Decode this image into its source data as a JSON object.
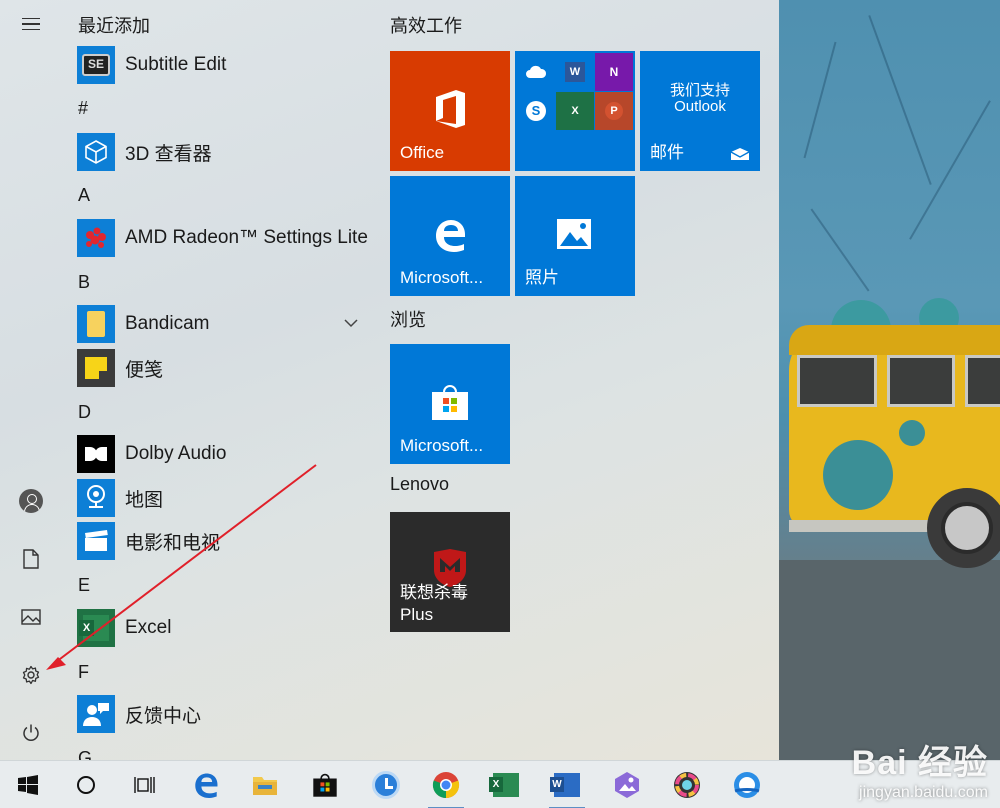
{
  "app_list": {
    "recently_added_header": "最近添加",
    "groups": [
      {
        "header": "#",
        "items": [
          {
            "label": "3D 查看器",
            "icon": "cube-icon"
          }
        ]
      },
      {
        "header": "A",
        "items": [
          {
            "label": "AMD Radeon™ Settings Lite",
            "icon": "amd-radeon-icon"
          }
        ]
      },
      {
        "header": "B",
        "items": [
          {
            "label": "Bandicam",
            "icon": "folder-icon"
          },
          {
            "label": "便笺",
            "icon": "sticky-note-icon"
          }
        ]
      },
      {
        "header": "D",
        "items": [
          {
            "label": "Dolby Audio",
            "icon": "dolby-icon"
          },
          {
            "label": "地图",
            "icon": "map-pin-icon"
          },
          {
            "label": "电影和电视",
            "icon": "clapperboard-icon"
          }
        ]
      },
      {
        "header": "E",
        "items": [
          {
            "label": "Excel",
            "icon": "excel-icon"
          }
        ]
      },
      {
        "header": "F",
        "items": [
          {
            "label": "反馈中心",
            "icon": "feedback-icon"
          }
        ]
      },
      {
        "header": "G",
        "items": []
      }
    ],
    "recent_items": [
      {
        "label": "Subtitle Edit",
        "icon": "subtitle-edit-icon"
      }
    ]
  },
  "tiles": {
    "sections": [
      {
        "title": "高效工作"
      },
      {
        "title": "浏览"
      },
      {
        "title": "Lenovo"
      }
    ],
    "office_label": "Office",
    "edge_label": "Microsoft...",
    "photos_label": "照片",
    "mail_heading": "我们支持",
    "mail_sub": "Outlook",
    "mail_label": "邮件",
    "store_label": "Microsoft...",
    "mcafee_line1": "联想杀毒",
    "mcafee_line2": "Plus"
  },
  "watermark": {
    "main": "Bai 经验",
    "sub": "jingyan.baidu.com"
  },
  "colors": {
    "tile_blue": "#0078d7",
    "office_red": "#d83b01",
    "lenovo_dark": "#2b2b2b",
    "arrow_red": "#e0202a"
  }
}
